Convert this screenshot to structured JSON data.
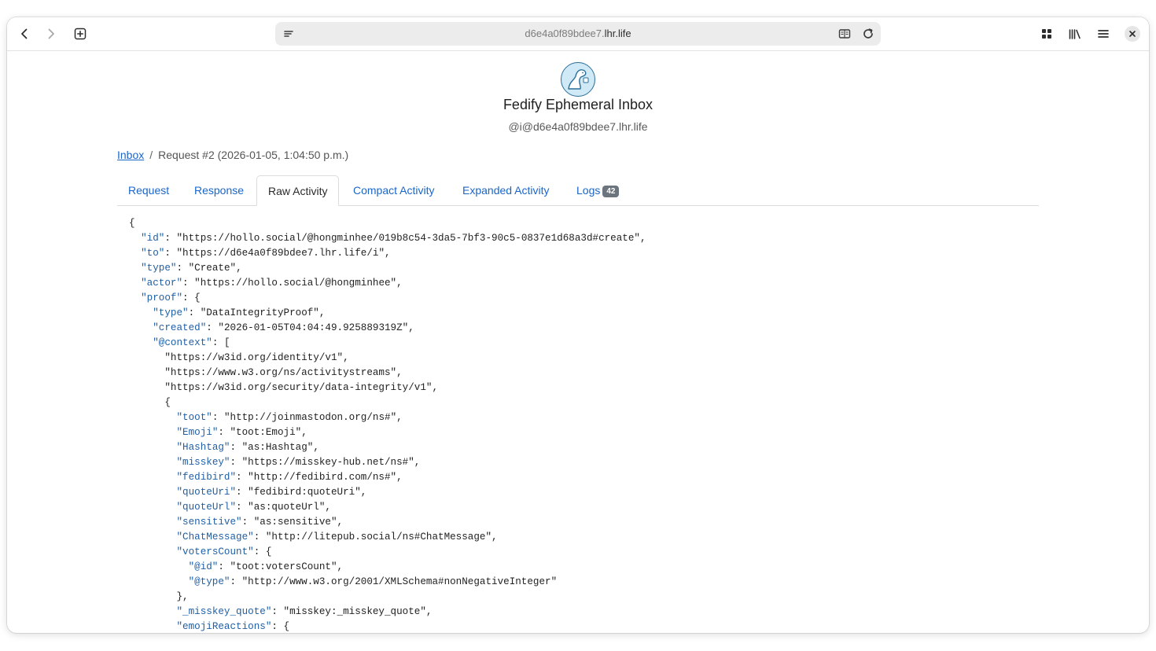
{
  "browser": {
    "url_prefix": "d6e4a0f89bdee7.",
    "url_host": "lhr.life",
    "icons": {
      "back": "chevron-left-icon",
      "forward": "chevron-right-icon",
      "new_tab": "new-tab-icon",
      "page_menu": "page-menu-icon",
      "reader": "reader-mode-icon",
      "reload": "reload-icon",
      "apps": "apps-grid-icon",
      "library": "library-icon",
      "menu": "hamburger-menu-icon",
      "close": "close-icon"
    }
  },
  "header": {
    "title": "Fedify Ephemeral Inbox",
    "handle": "@i@d6e4a0f89bdee7.lhr.life"
  },
  "breadcrumb": {
    "root": "Inbox",
    "separator": "/",
    "current": "Request #2 (2026-01-05, 1:04:50 p.m.)"
  },
  "tabs": [
    {
      "label": "Request",
      "active": false
    },
    {
      "label": "Response",
      "active": false
    },
    {
      "label": "Raw Activity",
      "active": true
    },
    {
      "label": "Compact Activity",
      "active": false
    },
    {
      "label": "Expanded Activity",
      "active": false
    },
    {
      "label": "Logs",
      "active": false,
      "badge": "42"
    }
  ],
  "code_lines": [
    {
      "indent": 0,
      "text": "{"
    },
    {
      "indent": 1,
      "key": "id",
      "value": "\"https://hollo.social/@hongminhee/019b8c54-3da5-7bf3-90c5-0837e1d68a3d#create\","
    },
    {
      "indent": 1,
      "key": "to",
      "value": "\"https://d6e4a0f89bdee7.lhr.life/i\","
    },
    {
      "indent": 1,
      "key": "type",
      "value": "\"Create\","
    },
    {
      "indent": 1,
      "key": "actor",
      "value": "\"https://hollo.social/@hongminhee\","
    },
    {
      "indent": 1,
      "key": "proof",
      "value": "{"
    },
    {
      "indent": 2,
      "key": "type",
      "value": "\"DataIntegrityProof\","
    },
    {
      "indent": 2,
      "key": "created",
      "value": "\"2026-01-05T04:04:49.925889319Z\","
    },
    {
      "indent": 2,
      "key": "@context",
      "value": "["
    },
    {
      "indent": 3,
      "text": "\"https://w3id.org/identity/v1\","
    },
    {
      "indent": 3,
      "text": "\"https://www.w3.org/ns/activitystreams\","
    },
    {
      "indent": 3,
      "text": "\"https://w3id.org/security/data-integrity/v1\","
    },
    {
      "indent": 3,
      "text": "{"
    },
    {
      "indent": 4,
      "key": "toot",
      "value": "\"http://joinmastodon.org/ns#\","
    },
    {
      "indent": 4,
      "key": "Emoji",
      "value": "\"toot:Emoji\","
    },
    {
      "indent": 4,
      "key": "Hashtag",
      "value": "\"as:Hashtag\","
    },
    {
      "indent": 4,
      "key": "misskey",
      "value": "\"https://misskey-hub.net/ns#\","
    },
    {
      "indent": 4,
      "key": "fedibird",
      "value": "\"http://fedibird.com/ns#\","
    },
    {
      "indent": 4,
      "key": "quoteUri",
      "value": "\"fedibird:quoteUri\","
    },
    {
      "indent": 4,
      "key": "quoteUrl",
      "value": "\"as:quoteUrl\","
    },
    {
      "indent": 4,
      "key": "sensitive",
      "value": "\"as:sensitive\","
    },
    {
      "indent": 4,
      "key": "ChatMessage",
      "value": "\"http://litepub.social/ns#ChatMessage\","
    },
    {
      "indent": 4,
      "key": "votersCount",
      "value": "{"
    },
    {
      "indent": 5,
      "key": "@id",
      "value": "\"toot:votersCount\","
    },
    {
      "indent": 5,
      "key": "@type",
      "value": "\"http://www.w3.org/2001/XMLSchema#nonNegativeInteger\""
    },
    {
      "indent": 4,
      "text": "},"
    },
    {
      "indent": 4,
      "key": "_misskey_quote",
      "value": "\"misskey:_misskey_quote\","
    },
    {
      "indent": 4,
      "key": "emojiReactions",
      "value": "{"
    }
  ]
}
